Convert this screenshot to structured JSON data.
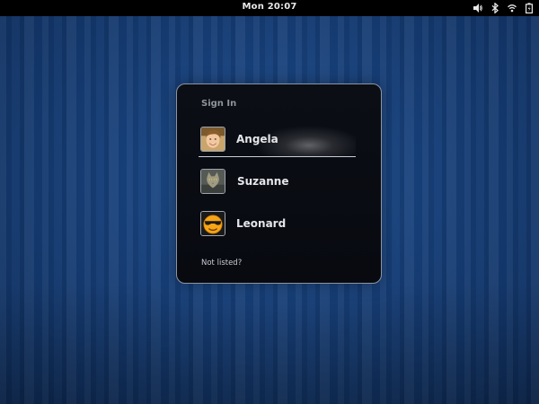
{
  "topbar": {
    "clock": "Mon 20:07",
    "status_icons": [
      "volume-icon",
      "bluetooth-icon",
      "wifi-icon",
      "battery-icon"
    ]
  },
  "login": {
    "title": "Sign In",
    "users": [
      {
        "name": "Angela",
        "avatar": "person-photo-avatar",
        "selected": true
      },
      {
        "name": "Suzanne",
        "avatar": "cat-avatar",
        "selected": false
      },
      {
        "name": "Leonard",
        "avatar": "smiley-sunglasses-avatar",
        "selected": false
      }
    ],
    "not_listed": "Not listed?"
  },
  "colors": {
    "background": "#143566",
    "panel": "#0b0e15",
    "panel_border": "#8c95a3"
  }
}
